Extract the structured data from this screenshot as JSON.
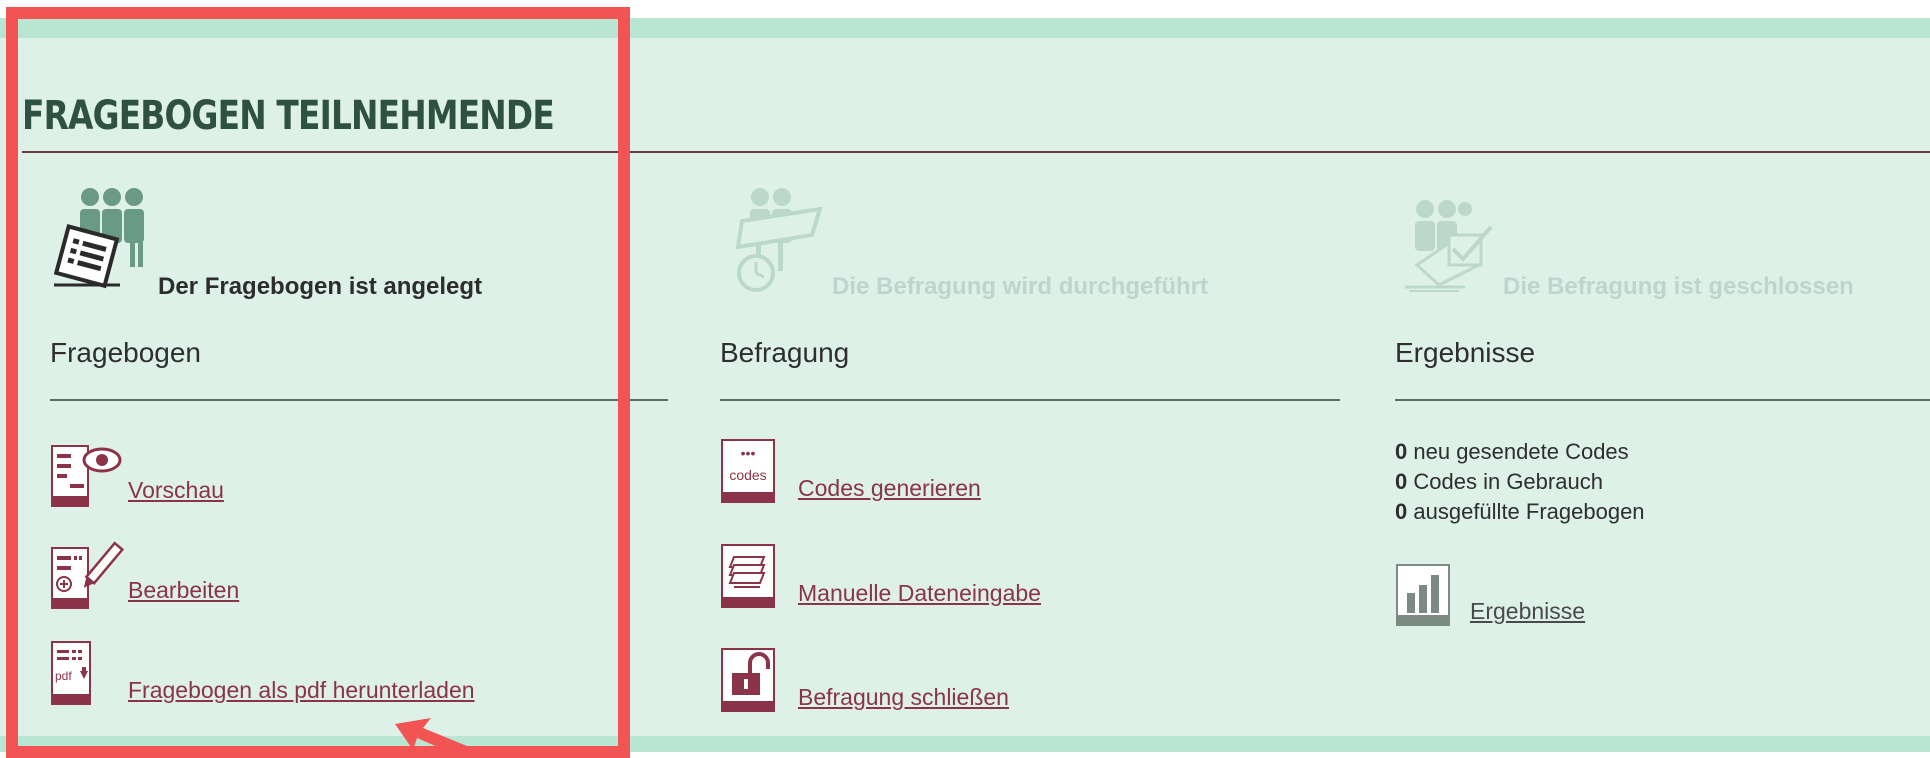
{
  "section": {
    "title": "FRAGEBOGEN TEILNEHMENDE"
  },
  "phases": [
    {
      "label": "Der Fragebogen ist angelegt",
      "state": "active",
      "icon": "participants-questionnaire-icon"
    },
    {
      "label": "Die Befragung wird durchgeführt",
      "state": "inactive",
      "icon": "participants-clock-icon"
    },
    {
      "label": "Die Befragung ist geschlossen",
      "state": "inactive",
      "icon": "participants-check-icon"
    }
  ],
  "columns": {
    "fragebogen": {
      "heading": "Fragebogen",
      "actions": [
        {
          "label": "Vorschau",
          "icon": "preview-eye-icon"
        },
        {
          "label": "Bearbeiten",
          "icon": "edit-pencil-icon"
        },
        {
          "label": "Fragebogen als pdf herunterladen",
          "icon": "pdf-download-icon"
        }
      ]
    },
    "befragung": {
      "heading": "Befragung",
      "actions": [
        {
          "label": "Codes generieren",
          "icon": "codes-icon",
          "icon_text": "codes",
          "icon_dots": "•••"
        },
        {
          "label": "Manuelle Dateneingabe",
          "icon": "stack-pages-icon"
        },
        {
          "label": "Befragung schließen",
          "icon": "lock-open-icon"
        }
      ]
    },
    "ergebnisse": {
      "heading": "Ergebnisse",
      "stats": [
        {
          "count": "0",
          "label": "neu gesendete Codes"
        },
        {
          "count": "0",
          "label": "Codes in Gebrauch"
        },
        {
          "count": "0",
          "label": "ausgefüllte Fragebogen"
        }
      ],
      "link": {
        "label": "Ergebnisse",
        "icon": "bar-chart-icon"
      }
    }
  },
  "icon_text": {
    "pdf": "pdf"
  },
  "colors": {
    "panel_bg": "#ddf1e8",
    "stripe": "#b9e6d3",
    "title": "#2f5144",
    "link": "#8a3349",
    "highlight": "#f25454",
    "inactive_text": "#bdd5cc"
  }
}
